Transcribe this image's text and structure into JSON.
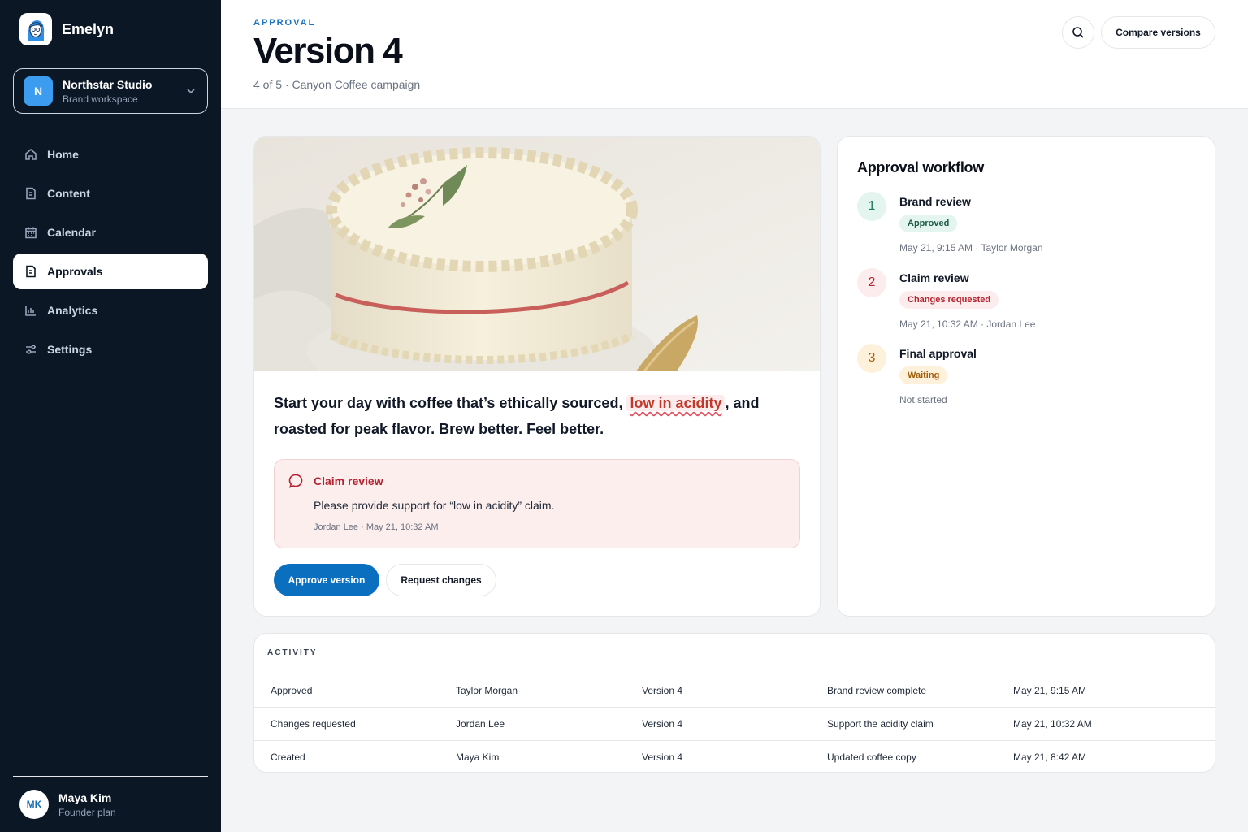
{
  "app": {
    "name": "Emelyn"
  },
  "workspace": {
    "name": "Northstar Studio",
    "sub": "Brand workspace",
    "initial": "N"
  },
  "nav": [
    {
      "label": "Home",
      "icon": "home-icon"
    },
    {
      "label": "Content",
      "icon": "document-icon"
    },
    {
      "label": "Calendar",
      "icon": "calendar-icon"
    },
    {
      "label": "Approvals",
      "icon": "document-icon",
      "active": true
    },
    {
      "label": "Analytics",
      "icon": "bar-chart-icon"
    },
    {
      "label": "Settings",
      "icon": "sliders-icon"
    }
  ],
  "user": {
    "initials": "MK",
    "name": "Maya Kim",
    "plan": "Founder plan"
  },
  "header": {
    "eyebrow": "APPROVAL",
    "title": "Version 4",
    "subtitle": "4 of 5 · Canyon Coffee campaign",
    "compare_label": "Compare versions"
  },
  "content": {
    "copy_before": "Start your day with coffee that’s ethically sourced, ",
    "copy_flagged": "low in acidity",
    "copy_after": ", and roasted for peak flavor. Brew better. Feel better.",
    "comment": {
      "title": "Claim review",
      "body": "Please provide support for “low in acidity” claim.",
      "meta": "Jordan Lee · May 21, 10:32 AM"
    },
    "approve_label": "Approve version",
    "changes_label": "Request changes"
  },
  "workflow": {
    "title": "Approval workflow",
    "steps": [
      {
        "num": "1",
        "name": "Brand review",
        "badge": "Approved",
        "meta": "May 21, 9:15 AM · Taylor Morgan",
        "color": "#1f7a5c",
        "bg": "#e3f5ee"
      },
      {
        "num": "2",
        "name": "Claim review",
        "badge": "Changes requested",
        "meta": "May 21, 10:32 AM · Jordan Lee",
        "color": "#b4232f",
        "bg": "#fdeced"
      },
      {
        "num": "3",
        "name": "Final approval",
        "badge": "Waiting",
        "meta": "Not started",
        "color": "#a45d0a",
        "bg": "#fdf1dc"
      }
    ]
  },
  "activity": {
    "title": "ACTIVITY",
    "rows": [
      [
        "Approved",
        "Taylor Morgan",
        "Version 4",
        "Brand review complete",
        "May 21, 9:15 AM"
      ],
      [
        "Changes requested",
        "Jordan Lee",
        "Version 4",
        "Support the acidity claim",
        "May 21, 10:32 AM"
      ],
      [
        "Created",
        "Maya Kim",
        "Version 4",
        "Updated coffee copy",
        "May 21, 8:42 AM"
      ]
    ]
  }
}
